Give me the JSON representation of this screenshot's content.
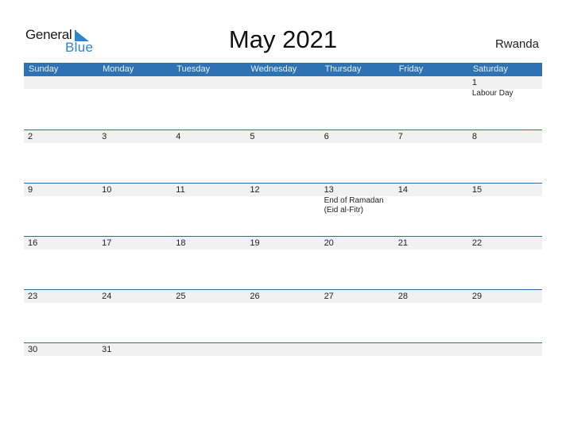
{
  "logo": {
    "general": "General",
    "blue": "Blue"
  },
  "title": "May 2021",
  "country": "Rwanda",
  "colors": {
    "header_bg": "#2e72b3",
    "accent": "#2f86c8",
    "band": "#f1f1f1"
  },
  "days": [
    "Sunday",
    "Monday",
    "Tuesday",
    "Wednesday",
    "Thursday",
    "Friday",
    "Saturday"
  ],
  "weeks": [
    [
      {
        "d": "",
        "e": ""
      },
      {
        "d": "",
        "e": ""
      },
      {
        "d": "",
        "e": ""
      },
      {
        "d": "",
        "e": ""
      },
      {
        "d": "",
        "e": ""
      },
      {
        "d": "",
        "e": ""
      },
      {
        "d": "1",
        "e": "Labour Day"
      }
    ],
    [
      {
        "d": "2",
        "e": ""
      },
      {
        "d": "3",
        "e": ""
      },
      {
        "d": "4",
        "e": ""
      },
      {
        "d": "5",
        "e": ""
      },
      {
        "d": "6",
        "e": ""
      },
      {
        "d": "7",
        "e": ""
      },
      {
        "d": "8",
        "e": ""
      }
    ],
    [
      {
        "d": "9",
        "e": ""
      },
      {
        "d": "10",
        "e": ""
      },
      {
        "d": "11",
        "e": ""
      },
      {
        "d": "12",
        "e": ""
      },
      {
        "d": "13",
        "e": "End of Ramadan (Eid al-Fitr)"
      },
      {
        "d": "14",
        "e": ""
      },
      {
        "d": "15",
        "e": ""
      }
    ],
    [
      {
        "d": "16",
        "e": ""
      },
      {
        "d": "17",
        "e": ""
      },
      {
        "d": "18",
        "e": ""
      },
      {
        "d": "19",
        "e": ""
      },
      {
        "d": "20",
        "e": ""
      },
      {
        "d": "21",
        "e": ""
      },
      {
        "d": "22",
        "e": ""
      }
    ],
    [
      {
        "d": "23",
        "e": ""
      },
      {
        "d": "24",
        "e": ""
      },
      {
        "d": "25",
        "e": ""
      },
      {
        "d": "26",
        "e": ""
      },
      {
        "d": "27",
        "e": ""
      },
      {
        "d": "28",
        "e": ""
      },
      {
        "d": "29",
        "e": ""
      }
    ],
    [
      {
        "d": "30",
        "e": ""
      },
      {
        "d": "31",
        "e": ""
      },
      {
        "d": "",
        "e": ""
      },
      {
        "d": "",
        "e": ""
      },
      {
        "d": "",
        "e": ""
      },
      {
        "d": "",
        "e": ""
      },
      {
        "d": "",
        "e": ""
      }
    ]
  ]
}
